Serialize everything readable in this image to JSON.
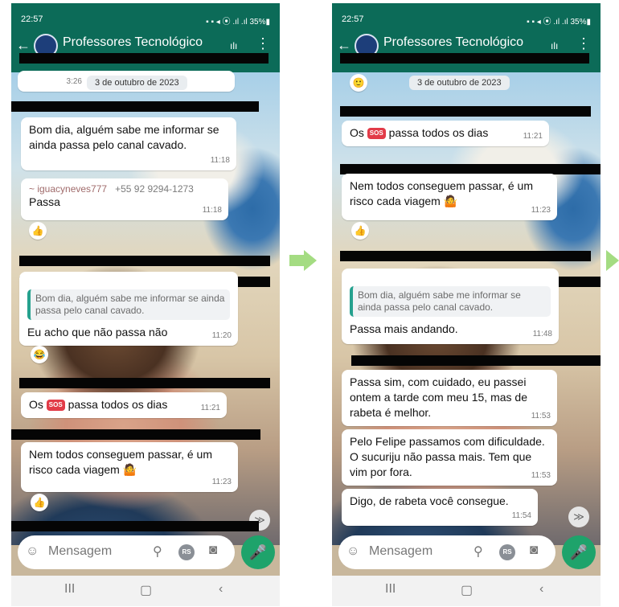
{
  "status": {
    "time": "22:57",
    "icons": "▪ ▪ ◂ ⦿ .ıl .ıl 35%▮"
  },
  "chat": {
    "title": "Professores Tecnológico",
    "wave_icon": "ılı",
    "menu_icon": "⋮",
    "back_icon": "←"
  },
  "input": {
    "placeholder": "Mensagem",
    "rs_label": "RS"
  },
  "nav": {
    "recents": "III",
    "home": "▢",
    "back": "‹"
  },
  "scroll_icon": "≫",
  "left": {
    "date": "3 de outubro de 2023",
    "first_time": "3:26",
    "messages": [
      {
        "text": "Bom dia, alguém sabe me informar se ainda passa pelo canal cavado.",
        "time": "11:18"
      },
      {
        "sender": "~ iguacyneves777",
        "number": "+55 92 9294-1273",
        "text": "Passa",
        "time": "11:18",
        "reaction": "👍"
      },
      {
        "quote": "Bom dia, alguém sabe me informar se ainda passa pelo canal cavado.",
        "text": "Eu acho que não passa não",
        "time": "11:20",
        "reaction": "😂"
      },
      {
        "pre": "Os",
        "sos": "SOS",
        "post": "passa todos os dias",
        "time": "11:21"
      },
      {
        "text": "Nem todos conseguem passar, é um risco cada viagem 🤷",
        "time": "11:23",
        "reaction": "👍"
      }
    ]
  },
  "right": {
    "date": "3 de outubro de 2023",
    "first_reaction": "🙂",
    "messages": [
      {
        "pre": "Os",
        "sos": "SOS",
        "post": "passa todos os dias",
        "time": "11:21"
      },
      {
        "text": "Nem todos conseguem passar, é um risco cada viagem 🤷",
        "time": "11:23",
        "reaction": "👍"
      },
      {
        "quote": "Bom dia, alguém sabe me informar se ainda passa pelo canal cavado.",
        "text": "Passa mais andando.",
        "time": "11:48"
      },
      {
        "text": "Passa sim, com cuidado, eu passei ontem a tarde com meu 15, mas de rabeta é melhor.",
        "time": "11:53"
      },
      {
        "text": "Pelo Felipe passamos com dificuldade.  O sucuriju não passa mais. Tem que vim por fora.",
        "time": "11:53"
      },
      {
        "text": "Digo, de rabeta você consegue.",
        "time": "11:54"
      }
    ]
  },
  "colors": {
    "header": "#0c6b58",
    "mic": "#1ea36b",
    "arrow": "#a4dc82",
    "redaction": "#050505"
  }
}
